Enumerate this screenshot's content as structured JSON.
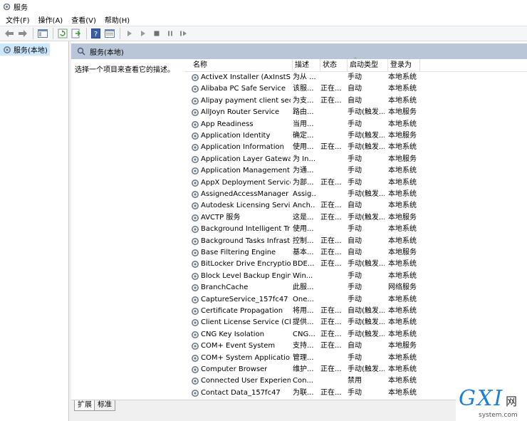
{
  "window": {
    "title": "服务"
  },
  "menu": [
    {
      "label": "文件(F)"
    },
    {
      "label": "操作(A)"
    },
    {
      "label": "查看(V)"
    },
    {
      "label": "帮助(H)"
    }
  ],
  "toolbar": {
    "icons": [
      "back-arrow-icon",
      "forward-arrow-icon",
      "show-tree-icon",
      "refresh-icon",
      "export-icon",
      "help-icon",
      "properties-icon",
      "play-icon",
      "play-outline-icon",
      "stop-icon",
      "pause-icon",
      "resume-icon"
    ]
  },
  "tree": {
    "item_label": "服务(本地)"
  },
  "main": {
    "header_title": "服务(本地)",
    "description_prompt": "选择一个项目来查看它的描述。"
  },
  "columns": {
    "name": "名称",
    "description": "描述",
    "status": "状态",
    "startup": "启动类型",
    "logon": "登录为"
  },
  "services": [
    {
      "name": "ActiveX Installer (AxInstSV)",
      "desc": "为从 ...",
      "status": "",
      "startup": "手动",
      "logon": "本地系统"
    },
    {
      "name": "Alibaba PC Safe Service",
      "desc": "该服...",
      "status": "正在...",
      "startup": "自动",
      "logon": "本地系统"
    },
    {
      "name": "Alipay payment client secu...",
      "desc": "为支...",
      "status": "正在...",
      "startup": "自动",
      "logon": "本地系统"
    },
    {
      "name": "AllJoyn Router Service",
      "desc": "路由...",
      "status": "",
      "startup": "手动(触发...",
      "logon": "本地服务"
    },
    {
      "name": "App Readiness",
      "desc": "当用...",
      "status": "",
      "startup": "手动",
      "logon": "本地系统"
    },
    {
      "name": "Application Identity",
      "desc": "确定...",
      "status": "",
      "startup": "手动(触发...",
      "logon": "本地服务"
    },
    {
      "name": "Application Information",
      "desc": "使用...",
      "status": "正在...",
      "startup": "手动(触发...",
      "logon": "本地系统"
    },
    {
      "name": "Application Layer Gateway ...",
      "desc": "为 In...",
      "status": "",
      "startup": "手动",
      "logon": "本地服务"
    },
    {
      "name": "Application Management",
      "desc": "为通...",
      "status": "",
      "startup": "手动",
      "logon": "本地系统"
    },
    {
      "name": "AppX Deployment Service ...",
      "desc": "为部...",
      "status": "正在...",
      "startup": "手动",
      "logon": "本地系统"
    },
    {
      "name": "AssignedAccessManager ...",
      "desc": "Assig...",
      "status": "",
      "startup": "手动(触发...",
      "logon": "本地系统"
    },
    {
      "name": "Autodesk Licensing Service",
      "desc": "Anch...",
      "status": "正在...",
      "startup": "自动",
      "logon": "本地系统"
    },
    {
      "name": "AVCTP 服务",
      "desc": "这是...",
      "status": "正在...",
      "startup": "手动(触发...",
      "logon": "本地服务"
    },
    {
      "name": "Background Intelligent Tra...",
      "desc": "使用...",
      "status": "",
      "startup": "手动",
      "logon": "本地系统"
    },
    {
      "name": "Background Tasks Infrastru...",
      "desc": "控制...",
      "status": "正在...",
      "startup": "自动",
      "logon": "本地系统"
    },
    {
      "name": "Base Filtering Engine",
      "desc": "基本...",
      "status": "正在...",
      "startup": "自动",
      "logon": "本地服务"
    },
    {
      "name": "BitLocker Drive Encryption ...",
      "desc": "BDE...",
      "status": "正在...",
      "startup": "手动(触发...",
      "logon": "本地系统"
    },
    {
      "name": "Block Level Backup Engine ...",
      "desc": "Win...",
      "status": "",
      "startup": "手动",
      "logon": "本地系统"
    },
    {
      "name": "BranchCache",
      "desc": "此服...",
      "status": "",
      "startup": "手动",
      "logon": "网络服务"
    },
    {
      "name": "CaptureService_157fc47",
      "desc": "One...",
      "status": "",
      "startup": "手动",
      "logon": "本地系统"
    },
    {
      "name": "Certificate Propagation",
      "desc": "将用...",
      "status": "正在...",
      "startup": "自动(触发...",
      "logon": "本地系统"
    },
    {
      "name": "Client License Service (Clip...",
      "desc": "提供...",
      "status": "正在...",
      "startup": "手动(触发...",
      "logon": "本地系统"
    },
    {
      "name": "CNG Key Isolation",
      "desc": "CNG...",
      "status": "正在...",
      "startup": "手动(触发...",
      "logon": "本地系统"
    },
    {
      "name": "COM+ Event System",
      "desc": "支持...",
      "status": "正在...",
      "startup": "自动",
      "logon": "本地服务"
    },
    {
      "name": "COM+ System Application",
      "desc": "管理...",
      "status": "",
      "startup": "手动",
      "logon": "本地系统"
    },
    {
      "name": "Computer Browser",
      "desc": "维护...",
      "status": "正在...",
      "startup": "手动(触发...",
      "logon": "本地系统"
    },
    {
      "name": "Connected User Experienc...",
      "desc": "Con...",
      "status": "",
      "startup": "禁用",
      "logon": "本地系统"
    },
    {
      "name": "Contact Data_157fc47",
      "desc": "为联...",
      "status": "正在...",
      "startup": "手动",
      "logon": "本地系统"
    }
  ],
  "tabs": [
    {
      "label": "扩展"
    },
    {
      "label": "标准"
    }
  ],
  "watermark": {
    "big": "GXI",
    "net": "网",
    "small": "system.com"
  },
  "colors": {
    "header_bg": "#b9c6d8",
    "selected_tree": "#cce8ff",
    "watermark_blue": "#1f7fd6"
  }
}
